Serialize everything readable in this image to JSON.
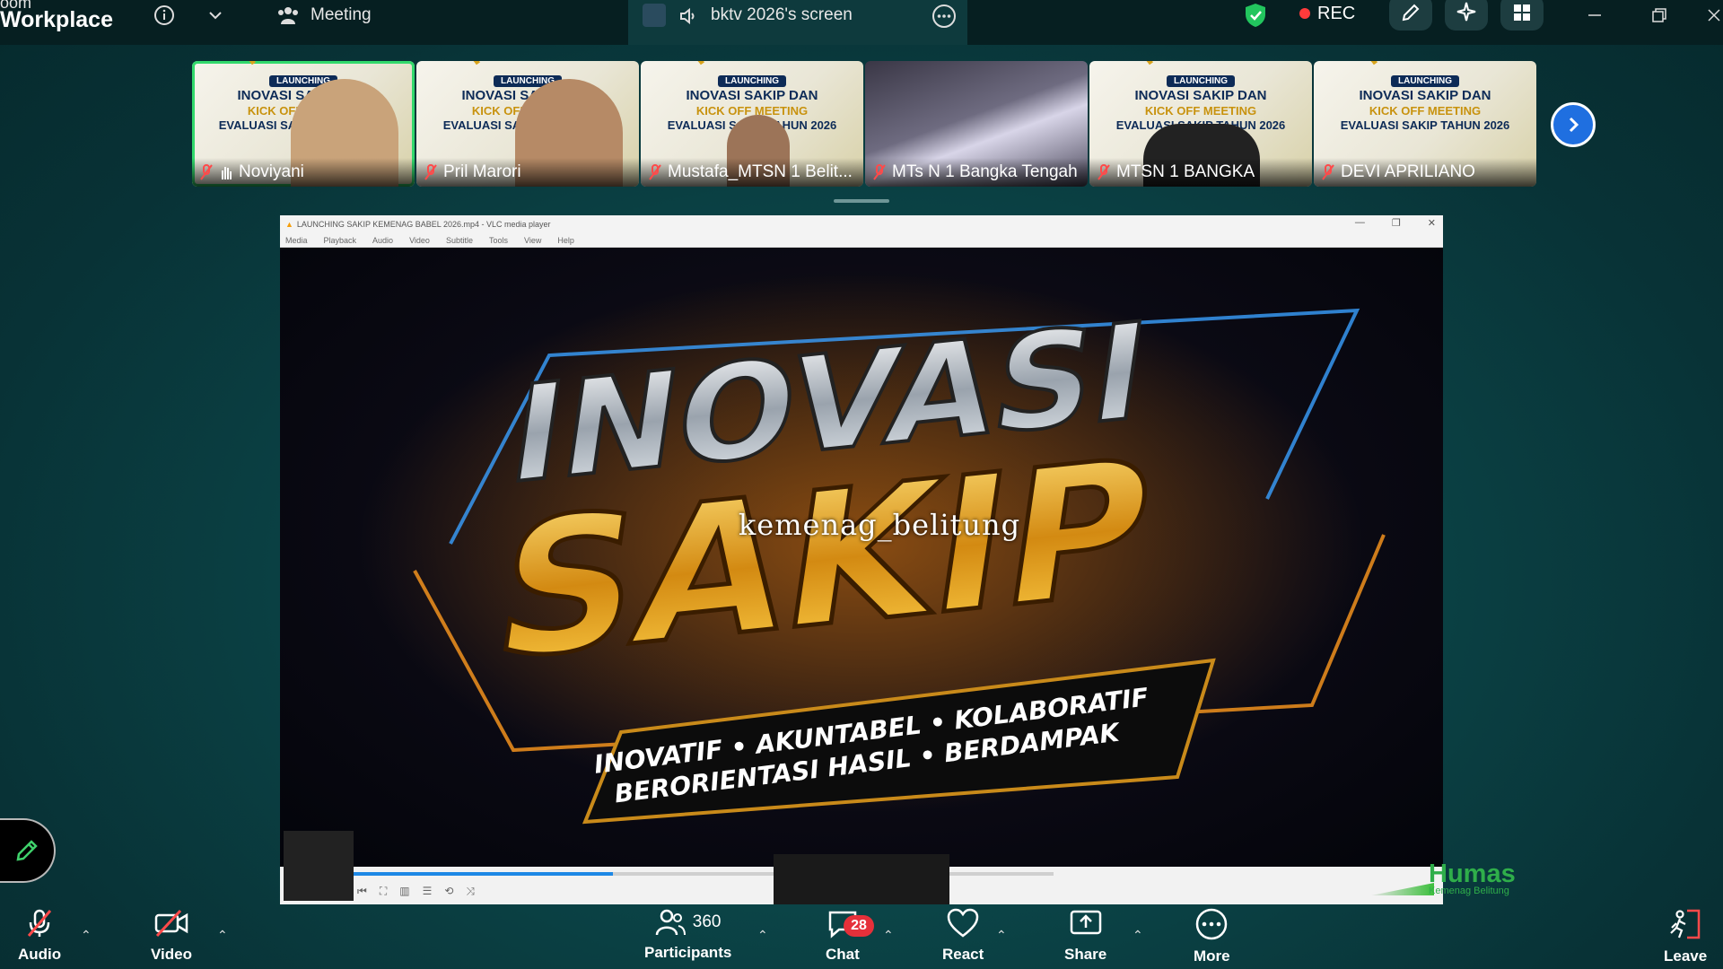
{
  "app": {
    "brand_top": "oom",
    "brand_bottom": "Workplace"
  },
  "topbar": {
    "meeting_label": "Meeting",
    "share_tab_label": "bktv 2026's screen",
    "rec_label": "REC",
    "icons": [
      "info-icon",
      "chevron-down-icon",
      "participants-icon",
      "speaker-icon",
      "more-icon",
      "shield-icon",
      "pencil-icon",
      "sparkle-icon",
      "apps-icon",
      "minimize-icon",
      "restore-icon",
      "close-icon"
    ]
  },
  "participants": [
    {
      "name": "Noviyani",
      "active": true
    },
    {
      "name": "Pril Marori",
      "active": false
    },
    {
      "name": "Mustafa_MTSN 1 Belit...",
      "active": false
    },
    {
      "name": "MTs N 1 Bangka Tengah",
      "active": false
    },
    {
      "name": "MTSN 1 BANGKA",
      "active": false
    },
    {
      "name": "DEVI APRILIANO",
      "active": false
    }
  ],
  "tile_banner": {
    "badge": "LAUNCHING",
    "line1": "INOVASI SAKIP DAN",
    "line2": "KICK OFF MEETING",
    "line3": "EVALUASI SAKIP TAHUN 2026"
  },
  "vlc": {
    "title": "LAUNCHING SAKIP KEMENAG BABEL 2026.mp4 - VLC media player",
    "menu": [
      "Media",
      "Playback",
      "Audio",
      "Video",
      "Subtitle",
      "Tools",
      "View",
      "Help"
    ],
    "progress": 0.37
  },
  "video": {
    "headline1": "INOVASI",
    "headline2": "SAKIP",
    "tag1": "INOVATIF • AKUNTABEL • KOLABORATIF",
    "tag2": "BERORIENTASI HASIL • BERDAMPAK"
  },
  "overlay_watermark": "kemenag_belitung",
  "humas": {
    "title": "Humas",
    "subtitle": "Kemenag Belitung"
  },
  "bottombar": {
    "audio": "Audio",
    "video": "Video",
    "participants": "Participants",
    "participants_count": "360",
    "chat": "Chat",
    "chat_badge": "28",
    "react": "React",
    "share": "Share",
    "more": "More",
    "leave": "Leave"
  },
  "colors": {
    "accent": "#32d96c",
    "rec": "#ff3b3b",
    "badge": "#e5303a",
    "next": "#1f6fe0",
    "humas": "#2fae4a"
  }
}
